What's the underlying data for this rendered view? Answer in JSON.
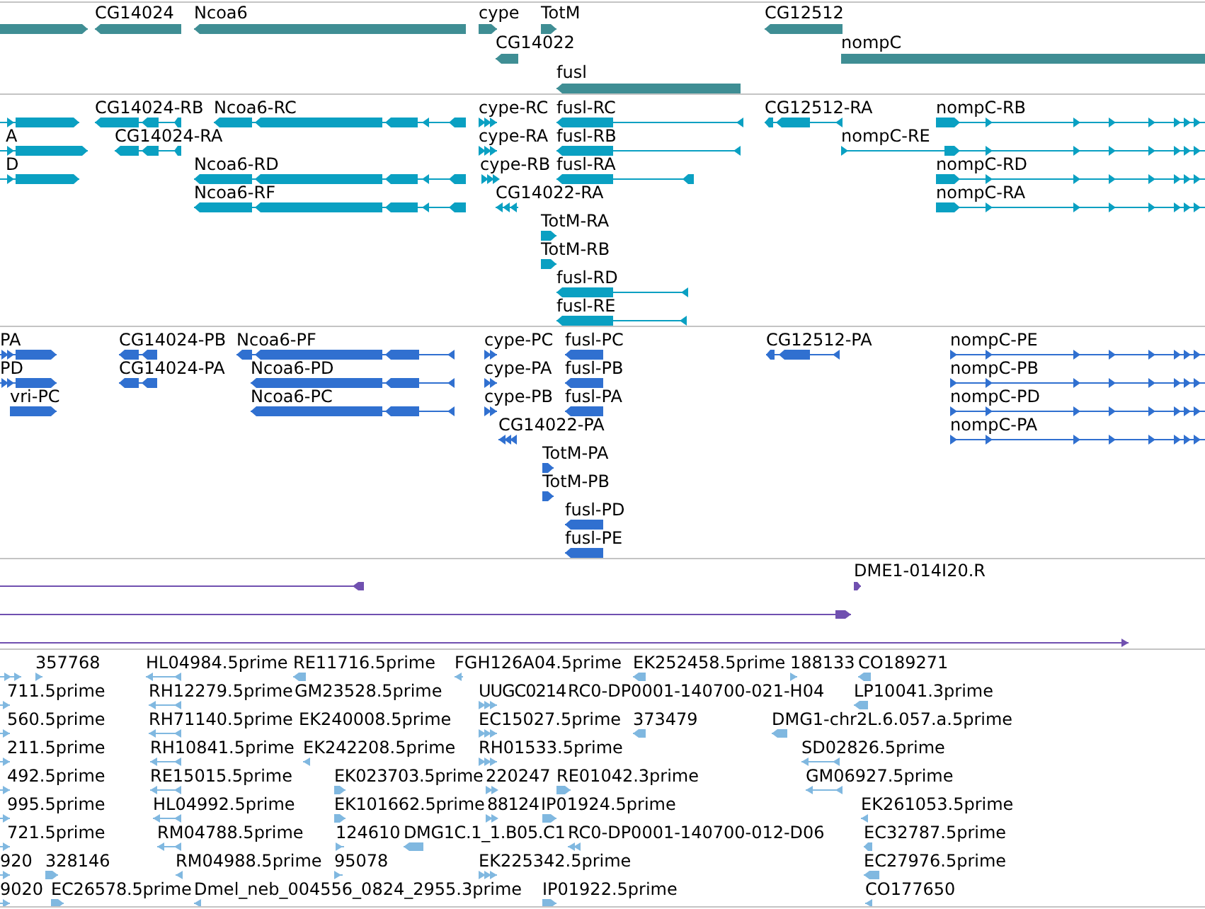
{
  "tracks": [
    {
      "kind": "gene",
      "color": "#3f8e94",
      "features": [
        {
          "reverse": false
        },
        {
          "label": "CG14024",
          "reverse": true
        },
        {
          "label": "Ncoa6",
          "reverse": true
        },
        {
          "label": "cype",
          "reverse": false
        },
        {
          "label": "TotM",
          "reverse": false
        },
        {
          "label": "CG12512",
          "reverse": true
        },
        {
          "label": "CG14022",
          "reverse": true
        },
        {
          "label": "nompC",
          "reverse": false
        },
        {
          "label": "fusl",
          "reverse": true
        }
      ]
    },
    {
      "kind": "transcript",
      "color": "#0aa0c2",
      "features": [
        {
          "reverse": false
        },
        {
          "label": "CG14024-RB",
          "reverse": true
        },
        {
          "label": "Ncoa6-RC",
          "reverse": true
        },
        {
          "label": "cype-RC",
          "reverse": false
        },
        {
          "label": "fusl-RC",
          "reverse": true
        },
        {
          "label": "CG12512-RA",
          "reverse": true
        },
        {
          "label": "nompC-RB",
          "reverse": false
        },
        {
          "label": "A",
          "reverse": false
        },
        {
          "label": "CG14024-RA",
          "reverse": true
        },
        {
          "label": "cype-RA",
          "reverse": false
        },
        {
          "label": "fusl-RB",
          "reverse": true
        },
        {
          "label": "nompC-RE",
          "reverse": false
        },
        {
          "label": "D",
          "reverse": false
        },
        {
          "label": "Ncoa6-RD",
          "reverse": true
        },
        {
          "label": "cype-RB",
          "reverse": false
        },
        {
          "label": "fusl-RA",
          "reverse": true
        },
        {
          "label": "nompC-RD",
          "reverse": false
        },
        {
          "label": "Ncoa6-RF",
          "reverse": true
        },
        {
          "label": "CG14022-RA",
          "reverse": true
        },
        {
          "label": "nompC-RA",
          "reverse": false
        },
        {
          "label": "TotM-RA",
          "reverse": false
        },
        {
          "label": "TotM-RB",
          "reverse": false
        },
        {
          "label": "fusl-RD",
          "reverse": true
        },
        {
          "label": "fusl-RE",
          "reverse": true
        }
      ]
    },
    {
      "kind": "protein",
      "color": "#3070d0",
      "features": [
        {
          "label": "PA",
          "reverse": false
        },
        {
          "label": "CG14024-PB",
          "reverse": true
        },
        {
          "label": "Ncoa6-PF",
          "reverse": true
        },
        {
          "label": "cype-PC",
          "reverse": false
        },
        {
          "label": "fusl-PC",
          "reverse": true
        },
        {
          "label": "CG12512-PA",
          "reverse": true
        },
        {
          "label": "nompC-PE",
          "reverse": false
        },
        {
          "label": "PD",
          "reverse": false
        },
        {
          "label": "CG14024-PA",
          "reverse": true
        },
        {
          "label": "Ncoa6-PD",
          "reverse": true
        },
        {
          "label": "cype-PA",
          "reverse": false
        },
        {
          "label": "fusl-PB",
          "reverse": true
        },
        {
          "label": "nompC-PB",
          "reverse": false
        },
        {
          "label": "vri-PC",
          "reverse": false
        },
        {
          "label": "Ncoa6-PC",
          "reverse": true
        },
        {
          "label": "cype-PB",
          "reverse": false
        },
        {
          "label": "fusl-PA",
          "reverse": true
        },
        {
          "label": "nompC-PD",
          "reverse": false
        },
        {
          "label": "CG14022-PA",
          "reverse": true
        },
        {
          "label": "nompC-PA",
          "reverse": false
        },
        {
          "label": "TotM-PA",
          "reverse": false
        },
        {
          "label": "TotM-PB",
          "reverse": false
        },
        {
          "label": "fusl-PD",
          "reverse": true
        },
        {
          "label": "fusl-PE",
          "reverse": true
        }
      ]
    },
    {
      "kind": "match",
      "color": "#7050b0",
      "features": [
        {
          "reverse": true
        },
        {
          "label": "DME1-014I20.R",
          "reverse": false
        },
        {
          "reverse": false
        },
        {
          "reverse": false
        }
      ]
    },
    {
      "kind": "est",
      "color": "#80b8e0",
      "features": [
        {
          "reverse": false
        },
        {
          "label": "357768",
          "reverse": false
        },
        {
          "label": "HL04984.5prime",
          "reverse": true
        },
        {
          "label": "RE11716.5prime",
          "reverse": true
        },
        {
          "label": "FGH126A04.5prime",
          "reverse": true
        },
        {
          "label": "EK252458.5prime",
          "reverse": true
        },
        {
          "label": "188133",
          "reverse": false
        },
        {
          "label": "CO189271",
          "reverse": true
        },
        {
          "label": "711.5prime",
          "reverse": false
        },
        {
          "label": "RH12279.5prime",
          "reverse": true
        },
        {
          "label": "GM23528.5prime"
        },
        {
          "label": "UUGC0214",
          "reverse": false
        },
        {
          "label": "RC0-DP0001-140700-021-H04"
        },
        {
          "label": "LP10041.3prime",
          "reverse": true
        },
        {
          "label": "560.5prime",
          "reverse": false
        },
        {
          "label": "RH71140.5prime",
          "reverse": true
        },
        {
          "label": "EK240008.5prime"
        },
        {
          "label": "EC15027.5prime",
          "reverse": false
        },
        {
          "label": "373479",
          "reverse": true
        },
        {
          "label": "DMG1-chr2L.6.057.a.5prime",
          "reverse": true
        },
        {
          "label": "211.5prime",
          "reverse": false
        },
        {
          "label": "RH10841.5prime",
          "reverse": true
        },
        {
          "label": "EK242208.5prime",
          "reverse": true
        },
        {
          "label": "RH01533.5prime",
          "reverse": false
        },
        {
          "label": "SD02826.5prime",
          "reverse": true
        },
        {
          "label": "492.5prime",
          "reverse": false
        },
        {
          "label": "RE15015.5prime",
          "reverse": true
        },
        {
          "label": "EK023703.5prime",
          "reverse": false
        },
        {
          "label": "220247",
          "reverse": false
        },
        {
          "label": "RE01042.3prime",
          "reverse": false
        },
        {
          "label": "GM06927.5prime",
          "reverse": true
        },
        {
          "label": "995.5prime",
          "reverse": false
        },
        {
          "label": "HL04992.5prime",
          "reverse": true
        },
        {
          "label": "EK101662.5prime",
          "reverse": false
        },
        {
          "label": "88124",
          "reverse": false
        },
        {
          "label": "IP01924.5prime",
          "reverse": false
        },
        {
          "label": "EK261053.5prime",
          "reverse": true
        },
        {
          "label": "721.5prime",
          "reverse": false
        },
        {
          "label": "RM04788.5prime",
          "reverse": true
        },
        {
          "label": "124610",
          "reverse": false
        },
        {
          "label": "DMG1C.1_1.B05.C1",
          "reverse": true
        },
        {
          "label": "RC0-DP0001-140700-012-D06",
          "reverse": true
        },
        {
          "label": "EC32787.5prime",
          "reverse": true
        },
        {
          "label": "920",
          "reverse": false
        },
        {
          "label": "328146",
          "reverse": false
        },
        {
          "label": "RM04988.5prime",
          "reverse": true
        },
        {
          "label": "95078",
          "reverse": false
        },
        {
          "label": "EK225342.5prime",
          "reverse": false
        },
        {
          "label": "EC27976.5prime",
          "reverse": true
        },
        {
          "label": "9020",
          "reverse": false
        },
        {
          "label": "EC26578.5prime",
          "reverse": false
        },
        {
          "label": "Dmel_neb_004556_0824_2955.3prime",
          "reverse": true
        },
        {
          "label": "IP01922.5prime",
          "reverse": false
        },
        {
          "label": "CO177650",
          "reverse": true
        }
      ]
    }
  ]
}
